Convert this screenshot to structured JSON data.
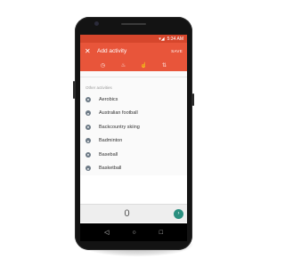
{
  "status_bar": {
    "time": "5:34 AM"
  },
  "app_bar": {
    "close_icon": "close-icon",
    "title": "Add activity",
    "save_label": "SAVE",
    "background": "#e8553a"
  },
  "tabs": [
    {
      "icon": "clock-icon"
    },
    {
      "icon": "flame-icon"
    },
    {
      "icon": "hand-icon"
    },
    {
      "icon": "swap-icon"
    }
  ],
  "section_label": "Other activities",
  "activities": [
    {
      "label": "Aerobics"
    },
    {
      "label": "Australian football"
    },
    {
      "label": "Backcountry skiing"
    },
    {
      "label": "Badminton"
    },
    {
      "label": "Baseball"
    },
    {
      "label": "Basketball"
    }
  ],
  "input": {
    "value": "0"
  }
}
